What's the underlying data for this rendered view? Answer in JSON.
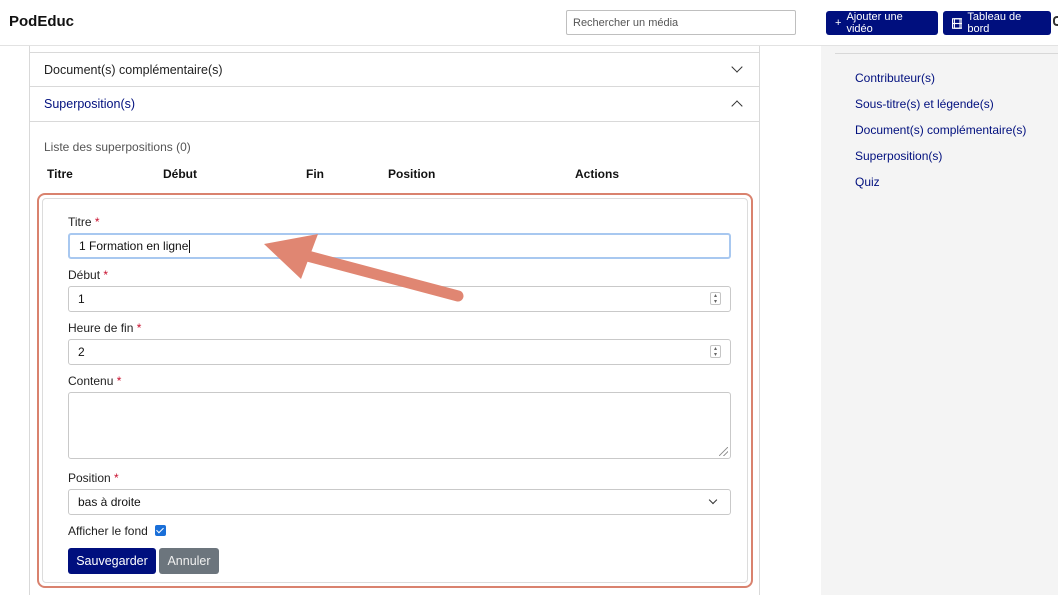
{
  "header": {
    "brand": "PodEduc",
    "search_placeholder": "Rechercher un média",
    "add_video_label": "Ajouter une vidéo",
    "dashboard_label": "Tableau de bord"
  },
  "aside": {
    "links": [
      "Contributeur(s)",
      "Sous-titre(s) et légende(s)",
      "Document(s) complémentaire(s)",
      "Superposition(s)",
      "Quiz"
    ]
  },
  "accordion": {
    "documents_title": "Document(s) complémentaire(s)",
    "overlays_title": "Superposition(s)"
  },
  "overlays": {
    "list_title": "Liste des superpositions (0)",
    "columns": [
      "Titre",
      "Début",
      "Fin",
      "Position",
      "Actions"
    ]
  },
  "form": {
    "title_label": "Titre",
    "title_value": "1 Formation en ligne",
    "start_label": "Début",
    "start_value": "1",
    "end_label": "Heure de fin",
    "end_value": "2",
    "content_label": "Contenu",
    "content_value": "",
    "position_label": "Position",
    "position_value": "bas à droite",
    "background_label": "Afficher le fond",
    "background_checked": true,
    "required_mark": "*",
    "save_label": "Sauvegarder",
    "cancel_label": "Annuler"
  },
  "colors": {
    "primary": "#000f7e",
    "secondary": "#6c757d",
    "annotation": "#e08672",
    "required": "#c8102e"
  }
}
